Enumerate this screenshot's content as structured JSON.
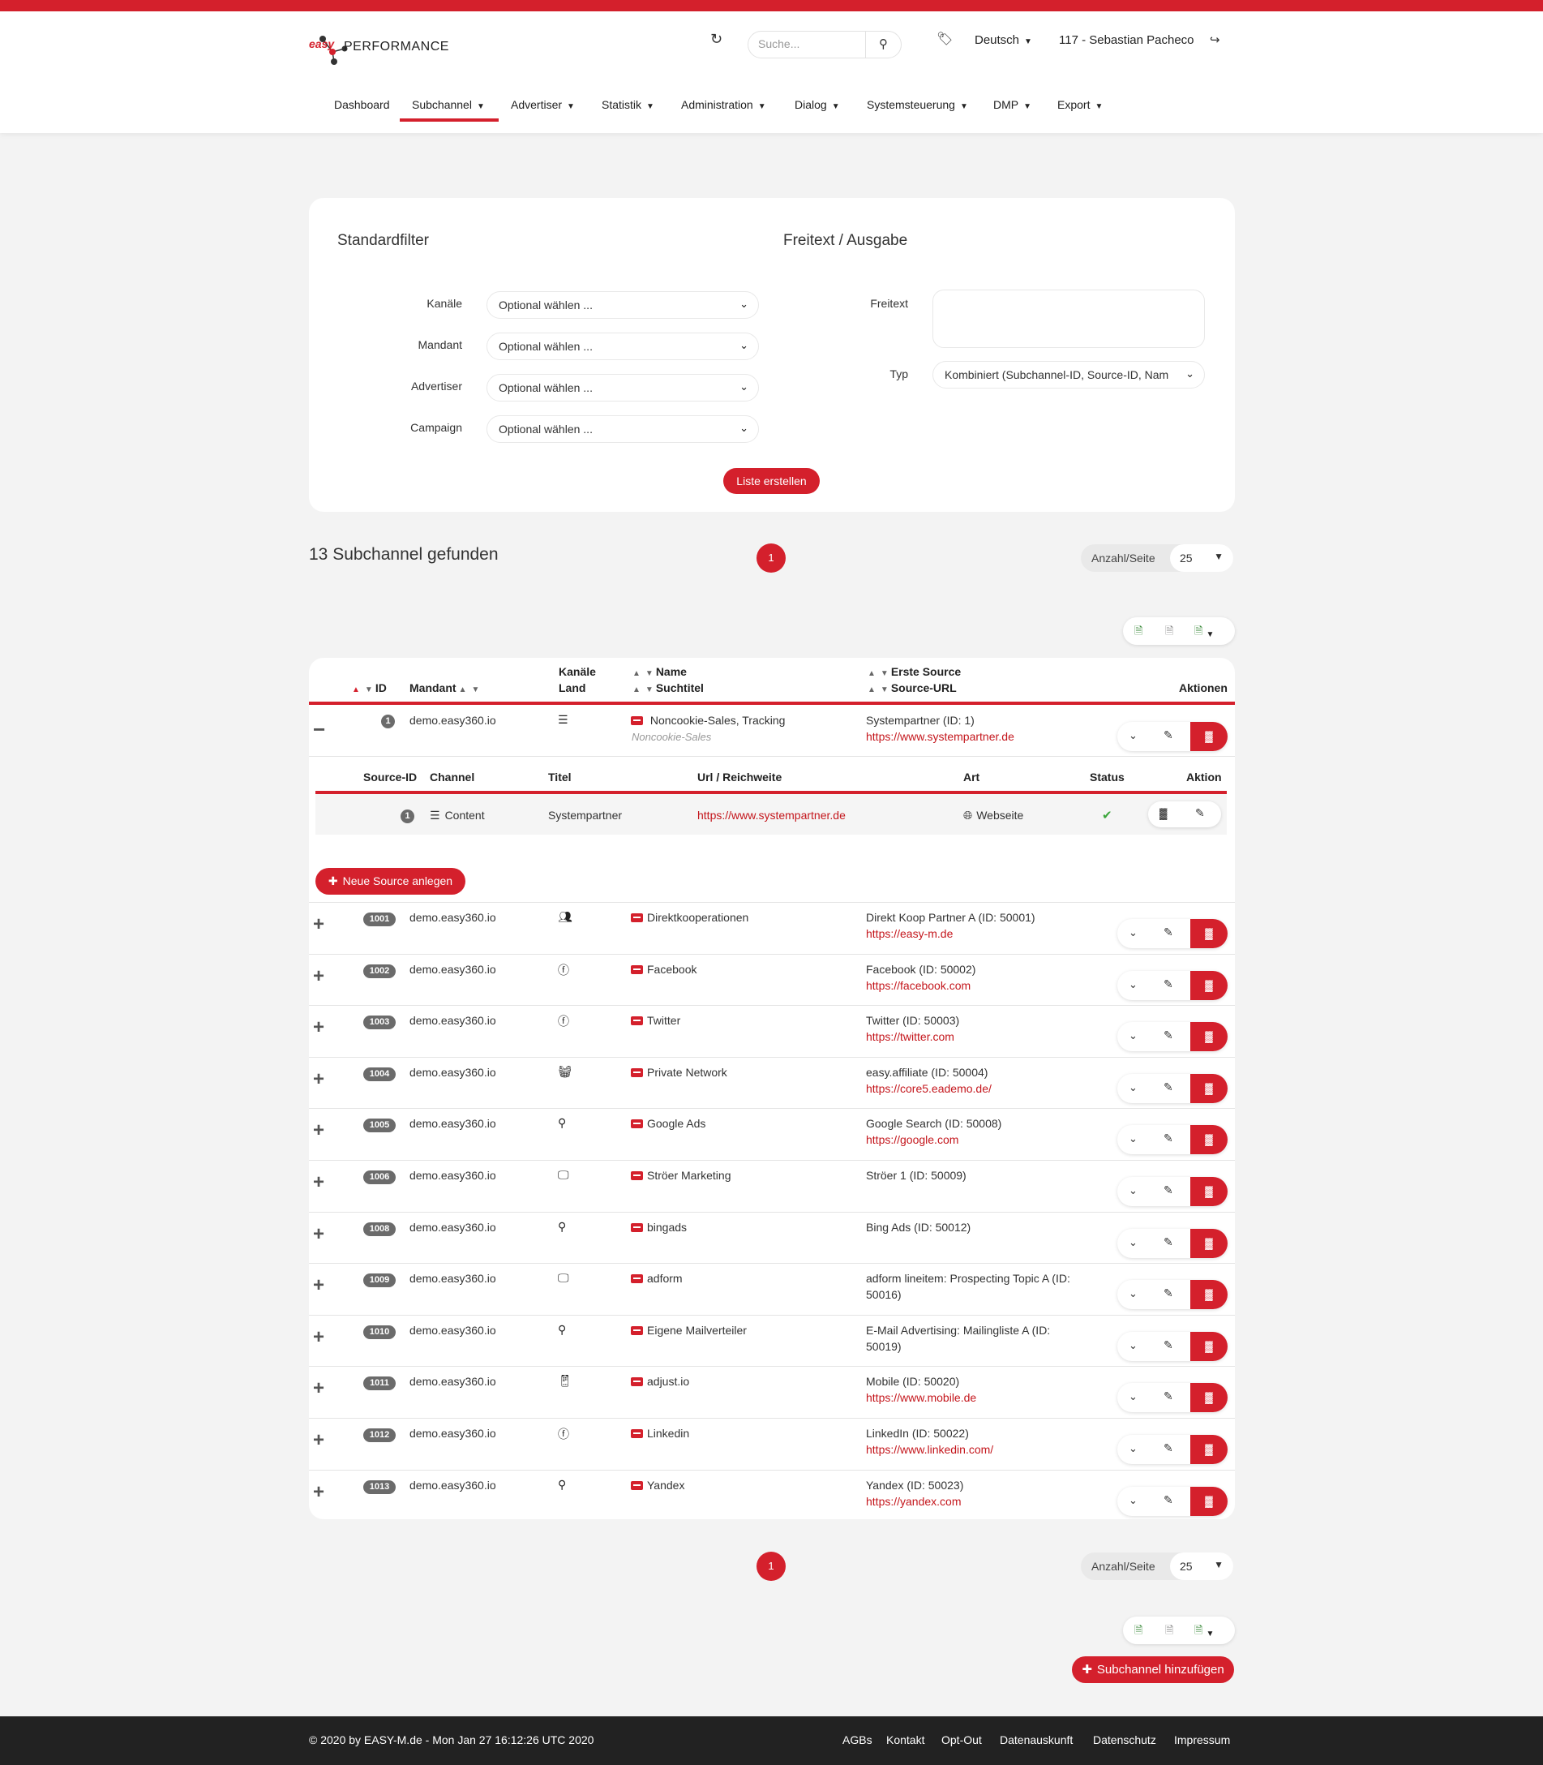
{
  "header": {
    "logo_easy": "easy",
    "logo_text": "PERFORMANCE",
    "search_placeholder": "Suche...",
    "language": "Deutsch",
    "user": "117 - Sebastian Pacheco"
  },
  "nav": [
    {
      "label": "Dashboard",
      "dropdown": false
    },
    {
      "label": "Subchannel",
      "dropdown": true,
      "active": true
    },
    {
      "label": "Advertiser",
      "dropdown": true
    },
    {
      "label": "Statistik",
      "dropdown": true
    },
    {
      "label": "Administration",
      "dropdown": true
    },
    {
      "label": "Dialog",
      "dropdown": true
    },
    {
      "label": "Systemsteuerung",
      "dropdown": true
    },
    {
      "label": "DMP",
      "dropdown": true
    },
    {
      "label": "Export",
      "dropdown": true
    }
  ],
  "filter": {
    "standard_title": "Standardfilter",
    "freitext_title": "Freitext / Ausgabe",
    "fields": [
      {
        "label": "Kanäle",
        "value": "Optional wählen ..."
      },
      {
        "label": "Mandant",
        "value": "Optional wählen ..."
      },
      {
        "label": "Advertiser",
        "value": "Optional wählen ..."
      },
      {
        "label": "Campaign",
        "value": "Optional wählen ..."
      }
    ],
    "freitext_label": "Freitext",
    "typ_label": "Typ",
    "typ_value": "Kombiniert (Subchannel-ID, Source-ID, Nam",
    "submit": "Liste erstellen"
  },
  "results": {
    "title": "13 Subchannel gefunden",
    "page": "1",
    "perpage_label": "Anzahl/Seite",
    "perpage_value": "25"
  },
  "table": {
    "headers": {
      "id": "ID",
      "mandant": "Mandant",
      "kanaele": "Kanäle",
      "land": "Land",
      "name": "Name",
      "suchtitel": "Suchtitel",
      "erste_source": "Erste Source",
      "source_url": "Source-URL",
      "aktionen": "Aktionen"
    },
    "expanded": {
      "id": "1",
      "mandant": "demo.easy360.io",
      "name": "Noncookie-Sales, Tracking",
      "suchtitel": "Noncookie-Sales",
      "source": "Systempartner (ID: 1)",
      "url": "https://www.systempartner.de",
      "sub_headers": {
        "source_id": "Source-ID",
        "channel": "Channel",
        "titel": "Titel",
        "url": "Url / Reichweite",
        "art": "Art",
        "status": "Status",
        "aktion": "Aktion"
      },
      "sub_row": {
        "source_id": "1",
        "channel": "Content",
        "titel": "Systempartner",
        "url": "https://www.systempartner.de",
        "art": "Webseite"
      },
      "new_source_label": "Neue Source anlegen"
    },
    "rows": [
      {
        "id": "1001",
        "mandant": "demo.easy360.io",
        "kanal_icon": "users-icon",
        "name": "Direktkooperationen",
        "source": "Direkt Koop Partner A (ID: 50001)",
        "source2": "",
        "url": "https://easy-m.de"
      },
      {
        "id": "1002",
        "mandant": "demo.easy360.io",
        "kanal_icon": "facebook-icon",
        "name": "Facebook",
        "source": "Facebook (ID: 50002)",
        "source2": "",
        "url": "https://facebook.com"
      },
      {
        "id": "1003",
        "mandant": "demo.easy360.io",
        "kanal_icon": "facebook-icon",
        "name": "Twitter",
        "source": "Twitter (ID: 50003)",
        "source2": "",
        "url": "https://twitter.com"
      },
      {
        "id": "1004",
        "mandant": "demo.easy360.io",
        "kanal_icon": "basket-icon",
        "name": "Private Network",
        "source": "easy.affiliate (ID: 50004)",
        "source2": "",
        "url": "https://core5.eademo.de/"
      },
      {
        "id": "1005",
        "mandant": "demo.easy360.io",
        "kanal_icon": "search-icon",
        "name": "Google Ads",
        "source": "Google Search (ID: 50008)",
        "source2": "",
        "url": "https://google.com"
      },
      {
        "id": "1006",
        "mandant": "demo.easy360.io",
        "kanal_icon": "monitor-icon",
        "name": "Ströer Marketing",
        "source": "Ströer 1 (ID: 50009)",
        "source2": "",
        "url": ""
      },
      {
        "id": "1008",
        "mandant": "demo.easy360.io",
        "kanal_icon": "search-icon",
        "name": "bingads",
        "source": "Bing Ads (ID: 50012)",
        "source2": "",
        "url": ""
      },
      {
        "id": "1009",
        "mandant": "demo.easy360.io",
        "kanal_icon": "monitor-icon",
        "name": "adform",
        "source": "adform lineitem: Prospecting Topic A (ID:",
        "source2": "50016)",
        "url": ""
      },
      {
        "id": "1010",
        "mandant": "demo.easy360.io",
        "kanal_icon": "search-icon",
        "name": "Eigene Mailverteiler",
        "source": "E-Mail Advertising: Mailingliste A (ID:",
        "source2": "50019)",
        "url": ""
      },
      {
        "id": "1011",
        "mandant": "demo.easy360.io",
        "kanal_icon": "mobile-icon",
        "name": "adjust.io",
        "source": "Mobile (ID: 50020)",
        "source2": "",
        "url": "https://www.mobile.de"
      },
      {
        "id": "1012",
        "mandant": "demo.easy360.io",
        "kanal_icon": "facebook-icon",
        "name": "Linkedin",
        "source": "LinkedIn (ID: 50022)",
        "source2": "",
        "url": "https://www.linkedin.com/"
      },
      {
        "id": "1013",
        "mandant": "demo.easy360.io",
        "kanal_icon": "search-icon",
        "name": "Yandex",
        "source": "Yandex (ID: 50023)",
        "source2": "",
        "url": "https://yandex.com"
      }
    ]
  },
  "bottom": {
    "add_label": "Subchannel hinzufügen"
  },
  "footer": {
    "copyright": "© 2020 by EASY-M.de - Mon Jan 27 16:12:26 UTC 2020",
    "links": [
      "AGBs",
      "Kontakt",
      "Opt-Out",
      "Datenauskunft",
      "Datenschutz",
      "Impressum"
    ]
  },
  "colors": {
    "accent": "#d4202c",
    "footer_bg": "#222222",
    "page_bg": "#f3f3f3"
  }
}
